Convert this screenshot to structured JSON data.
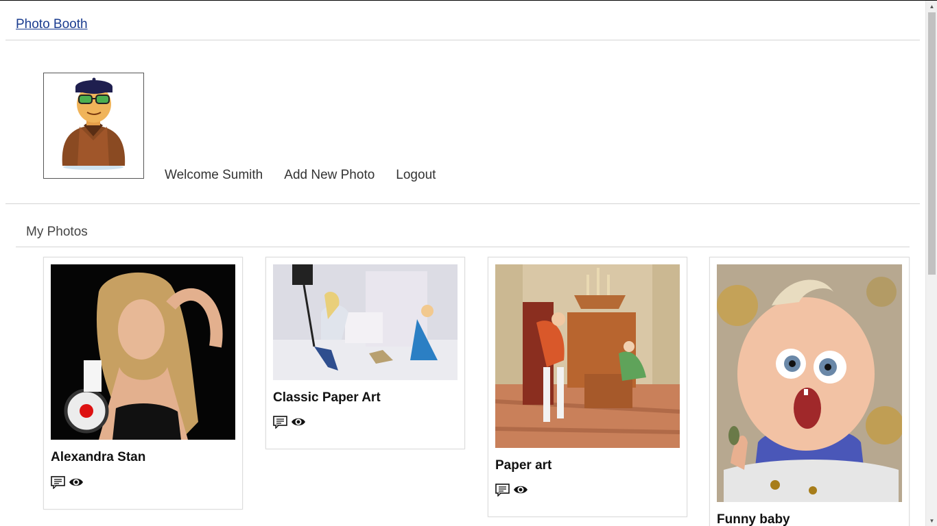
{
  "header": {
    "brand": "Photo Booth"
  },
  "profile": {
    "nav": {
      "welcome": "Welcome Sumith",
      "add_photo": "Add New Photo",
      "logout": "Logout"
    }
  },
  "section": {
    "title": "My Photos"
  },
  "photos": [
    {
      "title": "Alexandra Stan"
    },
    {
      "title": "Classic Paper Art"
    },
    {
      "title": "Paper art"
    },
    {
      "title": "Funny baby"
    }
  ],
  "colors": {
    "link": "#1a3c8f",
    "border": "#d4d4d4"
  },
  "icons": [
    "comment-icon",
    "eye-icon",
    "avatar-man-icon"
  ]
}
